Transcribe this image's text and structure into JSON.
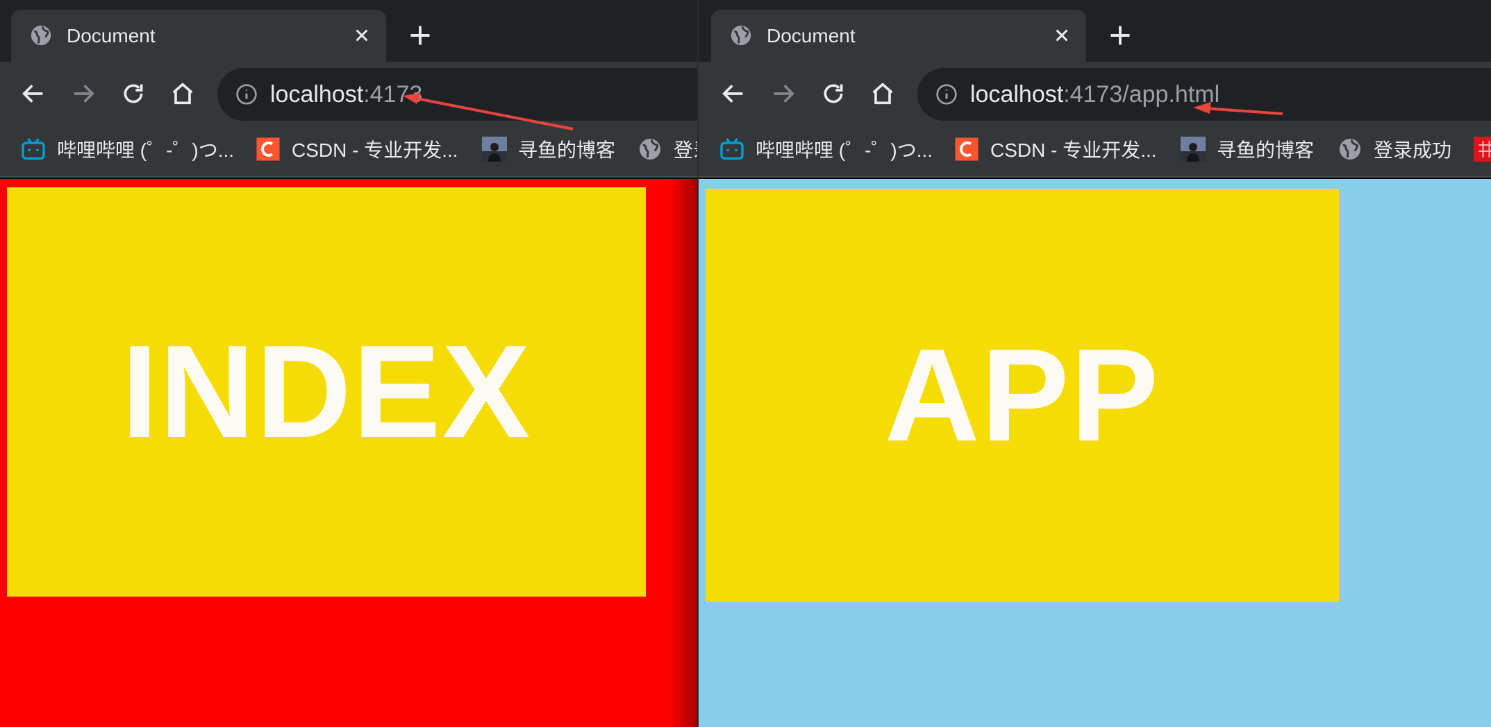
{
  "left_window": {
    "tab": {
      "title": "Document"
    },
    "address_bar": {
      "host": "localhost",
      "path": ":4173"
    },
    "bookmarks": [
      {
        "label": "哔哩哔哩 (゜-゜)つ...",
        "icon": "bilibili-icon"
      },
      {
        "label": "CSDN - 专业开发...",
        "icon": "csdn-icon"
      },
      {
        "label": "寻鱼的博客",
        "icon": "avatar-icon"
      },
      {
        "label": "登录成功",
        "icon": "globe-icon"
      }
    ],
    "page": {
      "background": "#ff0000",
      "panel_color": "#f5dc05",
      "panel_text": "INDEX"
    }
  },
  "right_window": {
    "tab": {
      "title": "Document"
    },
    "address_bar": {
      "host": "localhost",
      "path": ":4173/app.html"
    },
    "bookmarks": [
      {
        "label": "哔哩哔哩 (゜-゜)つ...",
        "icon": "bilibili-icon"
      },
      {
        "label": "CSDN - 专业开发...",
        "icon": "csdn-icon"
      },
      {
        "label": "寻鱼的博客",
        "icon": "avatar-icon"
      },
      {
        "label": "登录成功",
        "icon": "globe-icon"
      }
    ],
    "page": {
      "background": "#87ceeb",
      "panel_color": "#f5dc05",
      "panel_text": "APP"
    }
  },
  "annotation_color": "#e8453c"
}
